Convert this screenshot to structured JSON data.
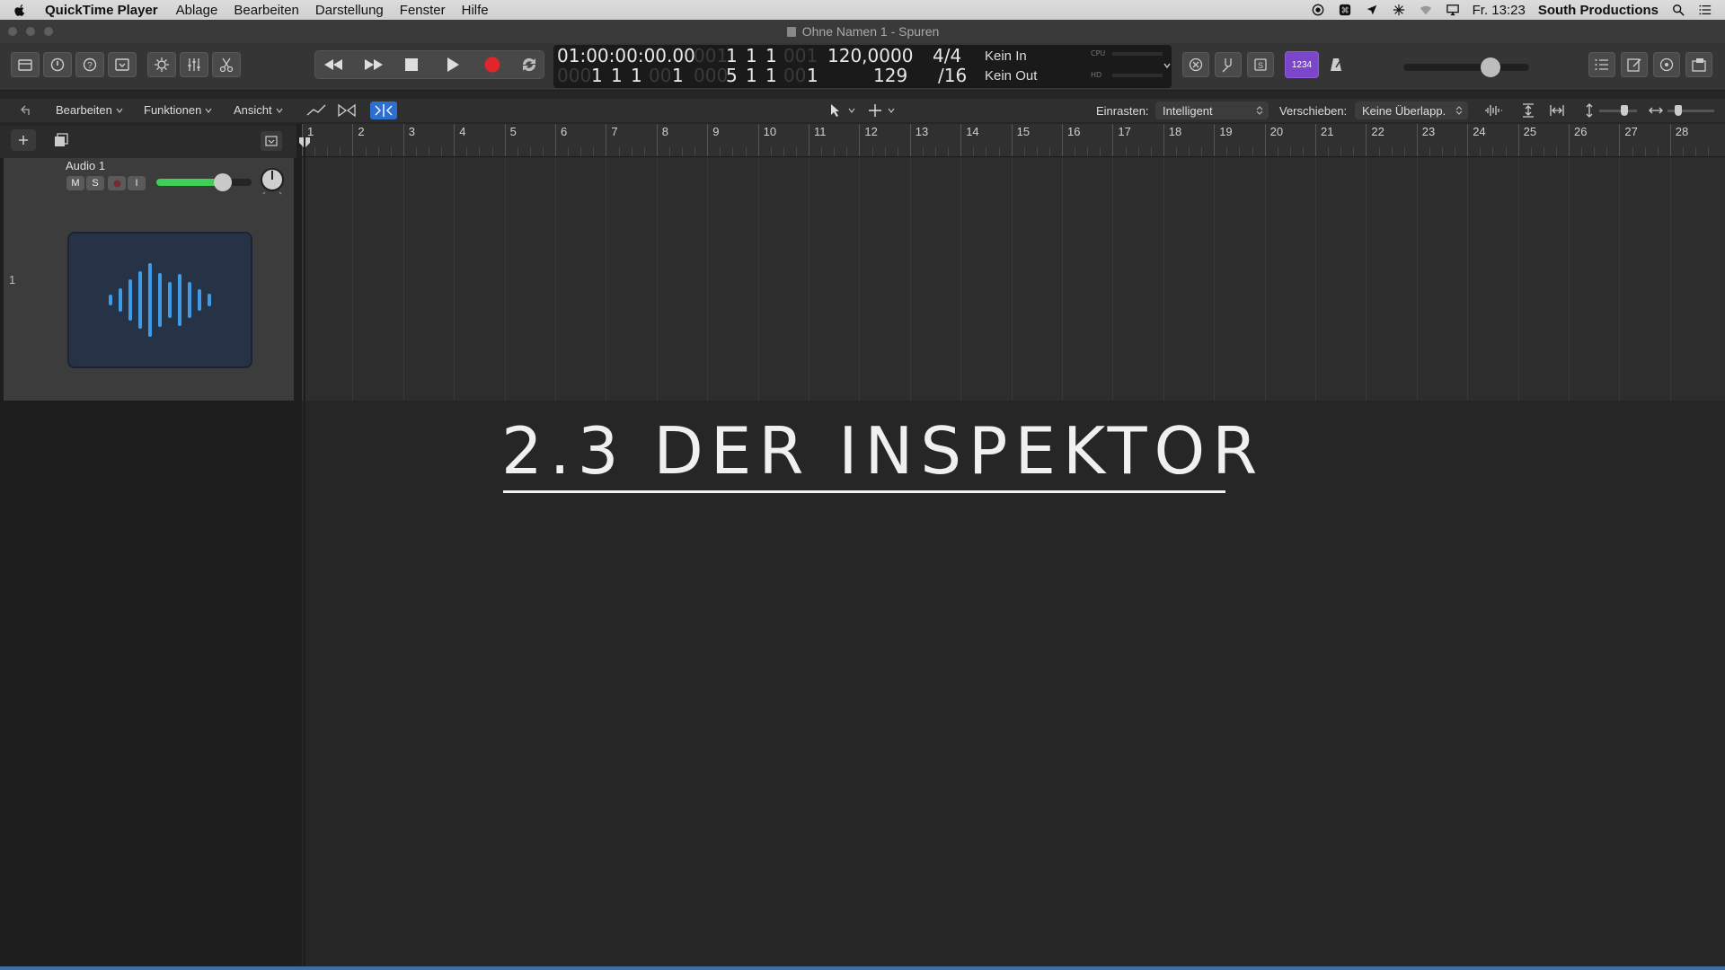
{
  "menubar": {
    "app_name": "QuickTime Player",
    "items": [
      "Ablage",
      "Bearbeiten",
      "Darstellung",
      "Fenster",
      "Hilfe"
    ],
    "clock": "Fr. 13:23",
    "user": "South Productions"
  },
  "window": {
    "title": "Ohne Namen 1 - Spuren"
  },
  "lcd": {
    "timecode": "01:00:00:00.00",
    "bar_top": [
      "1",
      "1",
      "1"
    ],
    "bar_top_dim": "001",
    "bar_top_dim2": "001",
    "bar_bottom": [
      "1",
      "1",
      "1"
    ],
    "bar_bottom_dim": "000",
    "bar_bottom_dim2": "001",
    "bar_bottom_tail": "1",
    "end_bottom": [
      "5",
      "1",
      "1"
    ],
    "end_bottom_dim": "000",
    "end_bottom_dim2": "001",
    "end_bottom_tail": "1",
    "tempo": "120,0000",
    "tempo_bottom": "129",
    "signature": "4/4",
    "division": "/16",
    "in_label": "Kein In",
    "out_label": "Kein Out",
    "cpu_label": "CPU",
    "hd_label": "HD",
    "count_in_label": "1234"
  },
  "localbar": {
    "menus": [
      "Bearbeiten",
      "Funktionen",
      "Ansicht"
    ],
    "snap_label": "Einrasten:",
    "snap_value": "Intelligent",
    "drag_label": "Verschieben:",
    "drag_value": "Keine Überlapp."
  },
  "track": {
    "name": "Audio 1",
    "number": "1",
    "mute": "M",
    "solo": "S",
    "input": "I",
    "volume": 0.7
  },
  "ruler": {
    "bars": [
      "1",
      "2",
      "3",
      "4",
      "5",
      "6",
      "7",
      "8",
      "9",
      "10",
      "11",
      "12",
      "13",
      "14",
      "15",
      "16",
      "17",
      "18",
      "19",
      "20",
      "21",
      "22",
      "23",
      "24",
      "25",
      "26",
      "27",
      "28"
    ]
  },
  "overlay": {
    "headline": "2.3 DER INSPEKTOR"
  },
  "colors": {
    "accent_purple": "#7b46c9",
    "record_red": "#e0262a",
    "volume_green": "#3fcf59",
    "waveform_blue": "#3f9be8"
  }
}
